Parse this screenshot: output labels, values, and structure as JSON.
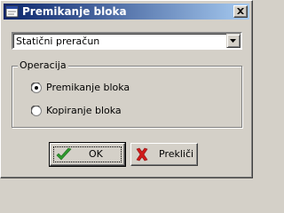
{
  "window": {
    "title": "Premikanje bloka",
    "close_icon": "close-icon"
  },
  "combo": {
    "value": "Statični preračun"
  },
  "group": {
    "label": "Operacija",
    "options": [
      {
        "label": "Premikanje bloka",
        "selected": true
      },
      {
        "label": "Kopiranje bloka",
        "selected": false
      }
    ]
  },
  "buttons": {
    "ok_label": "OK",
    "cancel_label": "Prekliči"
  },
  "colors": {
    "title_start": "#0a246a",
    "title_end": "#a6caf0",
    "face": "#d4d0c8",
    "ok_check": "#2e9a2e",
    "cancel_x": "#d11a1a"
  }
}
